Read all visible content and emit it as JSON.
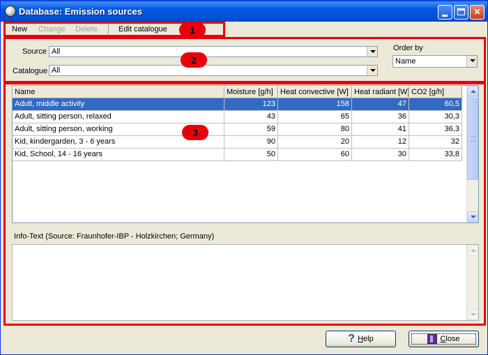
{
  "window": {
    "title": "Database: Emission sources"
  },
  "menu": {
    "new": "New",
    "change": "Change",
    "delete": "Delete",
    "edit_catalogue": "Edit catalogue"
  },
  "badges": [
    "1",
    "2",
    "3"
  ],
  "filters": {
    "source_label": "Source",
    "source_value": "All",
    "catalogue_label": "Catalogue",
    "catalogue_value": "All",
    "order_label": "Order by",
    "order_value": "Name"
  },
  "table": {
    "columns": [
      "Name",
      "Moisture [g/h]",
      "Heat convective [W]",
      "Heat radiant [W]",
      "CO2 [g/h]"
    ],
    "rows": [
      {
        "name": "Adult, middle activity",
        "moisture": "123",
        "heat_conv": "158",
        "heat_rad": "47",
        "co2": "60,5"
      },
      {
        "name": "Adult, sitting person, relaxed",
        "moisture": "43",
        "heat_conv": "65",
        "heat_rad": "36",
        "co2": "30,3"
      },
      {
        "name": "Adult, sitting person, working",
        "moisture": "59",
        "heat_conv": "80",
        "heat_rad": "41",
        "co2": "36,3"
      },
      {
        "name": "Kid, kindergarden, 3 - 6 years",
        "moisture": "90",
        "heat_conv": "20",
        "heat_rad": "12",
        "co2": "32"
      },
      {
        "name": "Kid, School, 14 - 16 years",
        "moisture": "50",
        "heat_conv": "60",
        "heat_rad": "30",
        "co2": "33,8"
      }
    ],
    "selected_row": 0
  },
  "info": {
    "label": "Info-Text  (Source: Fraunhofer-IBP - Holzkirchen; Germany)",
    "text": ""
  },
  "buttons": {
    "help_prefix": "H",
    "help_rest": "elp",
    "close_prefix": "C",
    "close_rest": "lose"
  },
  "colors": {
    "highlight": "#e8000d",
    "selection": "#316ac5",
    "titlebar": "#0458e3"
  }
}
